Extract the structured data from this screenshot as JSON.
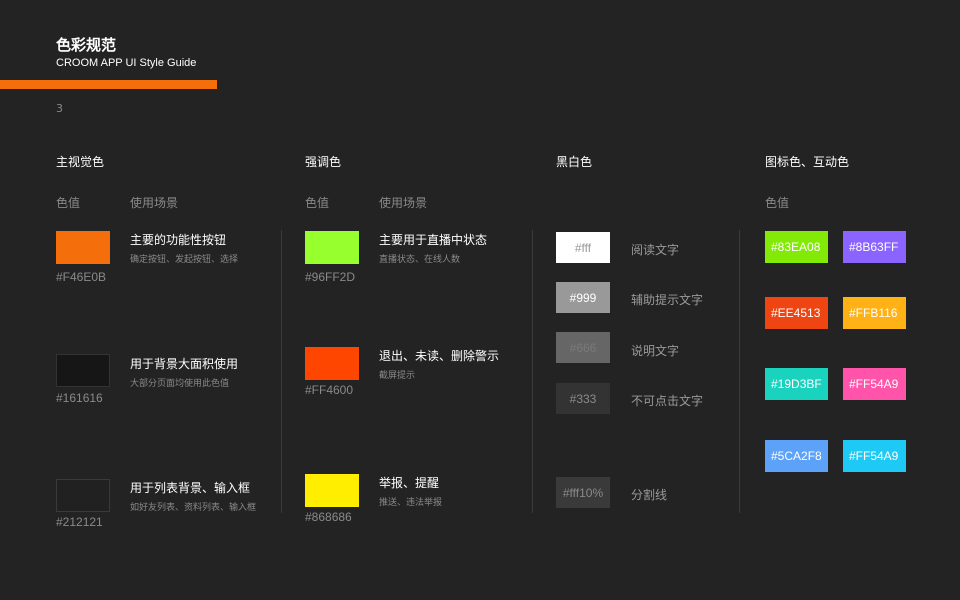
{
  "header": {
    "title": "色彩规范",
    "subtitle": "CROOM APP UI Style Guide",
    "page": "3",
    "accent": "#F46E0B"
  },
  "sections": {
    "main_visual": "主视觉色",
    "emphasis": "强调色",
    "black_white": "黑白色",
    "icon_interactive": "图标色、互动色"
  },
  "labels": {
    "color_value": "色值",
    "usage": "使用场景"
  },
  "main_colors": [
    {
      "hex": "#F46E0B",
      "color": "#F46E0B",
      "title": "主要的功能性按钮",
      "desc": "确定按钮、发起按钮、选择"
    },
    {
      "hex": "#161616",
      "color": "#161616",
      "title": "用于背景大面积使用",
      "desc": "大部分页面均使用此色值"
    },
    {
      "hex": "#212121",
      "color": "#212121",
      "title": "用于列表背景、输入框",
      "desc": "如好友列表、资料列表、输入框"
    }
  ],
  "emphasis_colors": [
    {
      "hex": "#96FF2D",
      "color": "#96FF2D",
      "title": "主要用于直播中状态",
      "desc": "直播状态、在线人数"
    },
    {
      "hex": "#FF4600",
      "color": "#FF4600",
      "title": "退出、未读、删除警示",
      "desc": "截屏提示"
    },
    {
      "hex": "#868686",
      "color": "#FFEE00",
      "title": "举报、提醒",
      "desc": "推送、违法举报"
    }
  ],
  "bw_colors": [
    {
      "chip": "#fff",
      "bg": "#FFFFFF",
      "fg": "#999999",
      "label": "阅读文字"
    },
    {
      "chip": "#999",
      "bg": "#999999",
      "fg": "#FFFFFF",
      "label": "辅助提示文字"
    },
    {
      "chip": "#666",
      "bg": "#666666",
      "fg": "#7a7a7a",
      "label": "说明文字"
    },
    {
      "chip": "#333",
      "bg": "#333333",
      "fg": "#8a8a8a",
      "label": "不可点击文字"
    },
    {
      "chip": "#fff10%",
      "bg": "#3a3a3a",
      "fg": "#8a8a8a",
      "label": "分割线"
    }
  ],
  "icon_colors": [
    {
      "hex": "#83EA08",
      "color": "#83EA08"
    },
    {
      "hex": "#8B63FF",
      "color": "#8B63FF"
    },
    {
      "hex": "#EE4513",
      "color": "#EE4513"
    },
    {
      "hex": "#FFB116",
      "color": "#FFB116"
    },
    {
      "hex": "#19D3BF",
      "color": "#19D3BF"
    },
    {
      "hex": "#FF54A9",
      "color": "#FF54A9"
    },
    {
      "hex": "#5CA2F8",
      "color": "#5CA2F8"
    },
    {
      "hex": "#FF54A9",
      "color": "#1FC9F5"
    }
  ]
}
